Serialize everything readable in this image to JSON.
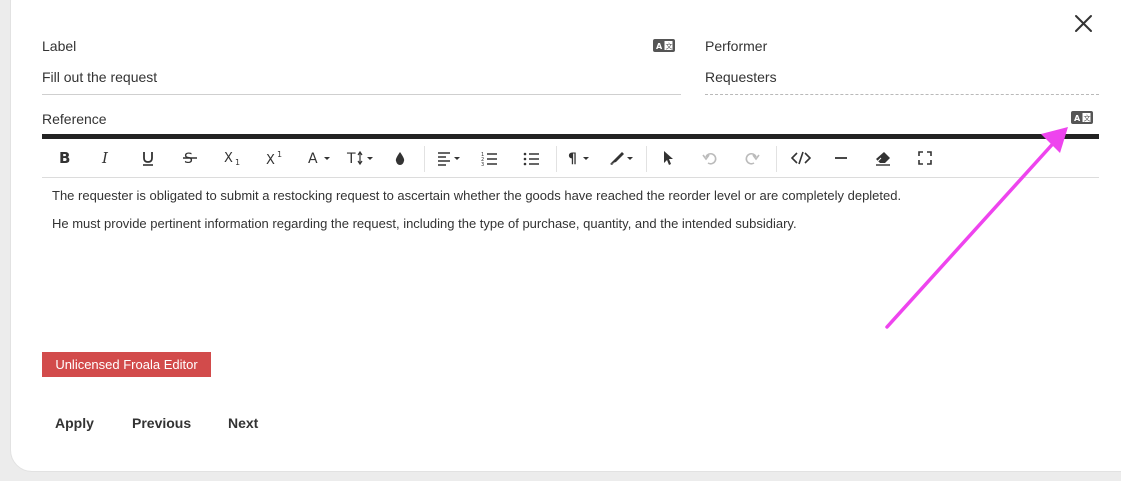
{
  "form": {
    "label_title": "Label",
    "label_value": "Fill out the request",
    "performer_title": "Performer",
    "performer_value": "Requesters",
    "reference_title": "Reference"
  },
  "editor": {
    "paragraphs": [
      "The requester is obligated to submit a restocking request to ascertain whether the goods have reached the reorder level or are completely depleted.",
      "He must provide pertinent information regarding the request, including the type of purchase, quantity, and the intended subsidiary."
    ],
    "license_badge": "Unlicensed Froala Editor",
    "toolbar_icons": [
      "bold-icon",
      "italic-icon",
      "underline-icon",
      "strikethrough-icon",
      "subscript-icon",
      "superscript-icon",
      "font-family-icon",
      "font-size-icon",
      "text-color-icon",
      "align-icon",
      "ordered-list-icon",
      "unordered-list-icon",
      "paragraph-format-icon",
      "inline-style-icon",
      "select-all-icon",
      "undo-icon",
      "redo-icon",
      "code-view-icon",
      "horizontal-line-icon",
      "clear-formatting-icon",
      "fullscreen-icon"
    ]
  },
  "actions": {
    "apply": "Apply",
    "previous": "Previous",
    "next": "Next"
  },
  "colors": {
    "badge": "#d24b4b",
    "annotation_arrow": "#ee44ee"
  }
}
